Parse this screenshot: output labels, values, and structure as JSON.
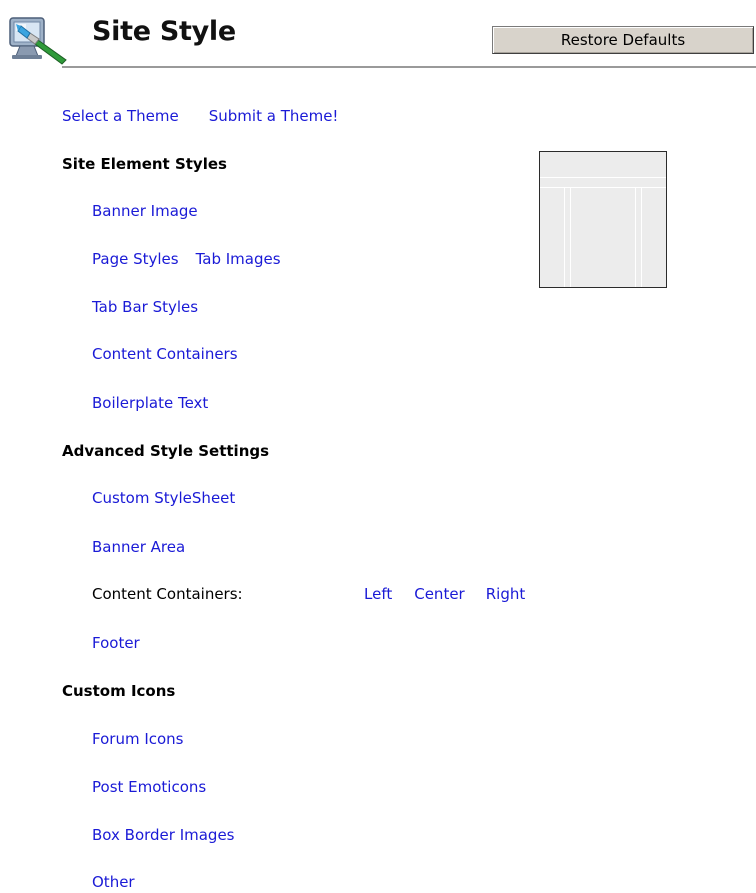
{
  "header": {
    "title": "Site Style",
    "icon": "site-style-paintbrush-monitor-icon",
    "restore_label": "Restore Defaults"
  },
  "themes": {
    "select_label": "Select a Theme",
    "submit_label": "Submit a Theme!"
  },
  "site_element_styles": {
    "heading": "Site Element Styles",
    "banner_image": "Banner Image",
    "page_styles": "Page Styles",
    "tab_images": "Tab Images",
    "tab_bar_styles": "Tab Bar Styles",
    "content_containers": "Content Containers",
    "boilerplate_text": "Boilerplate Text"
  },
  "advanced": {
    "heading": "Advanced Style Settings",
    "custom_stylesheet": "Custom StyleSheet",
    "banner_area": "Banner Area",
    "content_containers_label": "Content Containers:",
    "left": "Left",
    "center": "Center",
    "right": "Right",
    "footer": "Footer"
  },
  "custom_icons": {
    "heading": "Custom Icons",
    "forum_icons": "Forum Icons",
    "post_emoticons": "Post Emoticons",
    "box_border_images": "Box Border Images",
    "other": "Other"
  },
  "colors": {
    "link": "#1a1ad6",
    "button_face": "#d8d3cb",
    "rule": "#9a9a9a"
  }
}
